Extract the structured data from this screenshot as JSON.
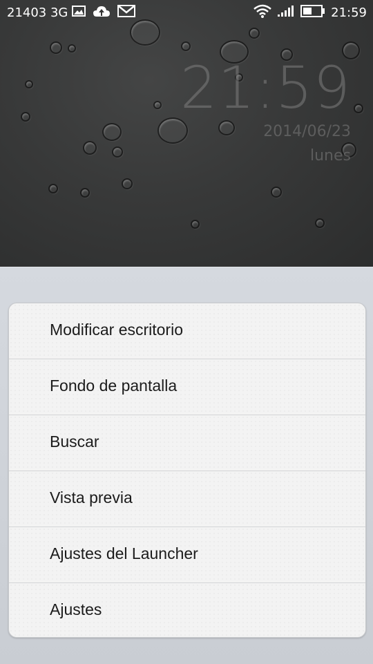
{
  "status_bar": {
    "carrier": "21403 3G",
    "time": "21:59",
    "icons": [
      "image-icon",
      "cloud-upload-icon",
      "gmail-icon",
      "wifi-icon",
      "signal-icon",
      "battery-icon"
    ]
  },
  "clock_widget": {
    "time": "21:59",
    "date": "2014/06/23",
    "day": "lunes"
  },
  "menu": {
    "items": [
      {
        "label": "Modificar escritorio"
      },
      {
        "label": "Fondo de pantalla"
      },
      {
        "label": "Buscar"
      },
      {
        "label": "Vista previa"
      },
      {
        "label": "Ajustes del Launcher"
      },
      {
        "label": "Ajustes"
      }
    ]
  }
}
